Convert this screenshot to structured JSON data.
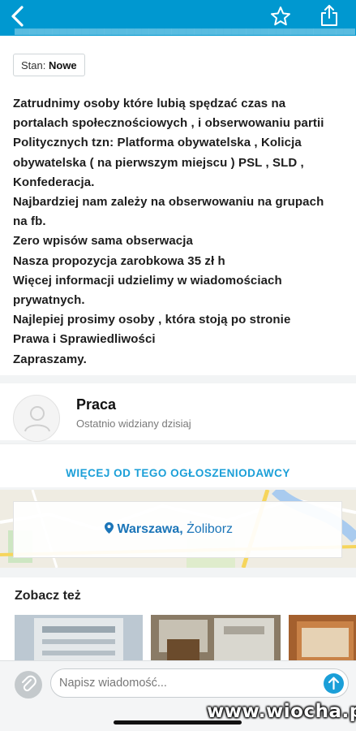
{
  "colors": {
    "brand": "#0098d0",
    "link": "#1b9fd8",
    "location": "#1b75b8"
  },
  "header": {
    "back_icon": "chevron-left-icon",
    "favorite_icon": "star-outline-icon",
    "share_icon": "share-icon"
  },
  "listing": {
    "condition_label": "Stan:",
    "condition_value": "Nowe",
    "description": "Zatrudnimy osoby które lubią spędzać czas na\nportalach społecznościowych , i obserwowaniu partii\nPolitycznych tzn: Platforma obywatelska , Kolicja\nobywatelska ( na pierwszym miejscu ) PSL , SLD ,\nKonfederacja.\nNajbardziej nam zależy na obserwowaniu na grupach\nna fb.\nZero wpisów sama obserwacja\nNasza propozycja zarobkowa 35 zł h\nWięcej informacji udzielimy w wiadomościach\nprywatnych.\nNajlepiej prosimy osoby , która stoją po stronie\nPrawa i Sprawiedliwości\nZapraszamy."
  },
  "seller": {
    "name": "Praca",
    "last_seen": "Ostatnio widziany dzisiaj",
    "more_link": "WIĘCEJ OD TEGO OGŁOSZENIODAWCY"
  },
  "location": {
    "icon": "map-pin-icon",
    "city": "Warszawa,",
    "district": "Żoliborz"
  },
  "see_also": {
    "title": "Zobacz też"
  },
  "compose": {
    "placeholder": "Napisz wiadomość...",
    "attach_icon": "paperclip-icon",
    "send_icon": "arrow-up-icon"
  },
  "watermark": "www.wiocha.pl"
}
